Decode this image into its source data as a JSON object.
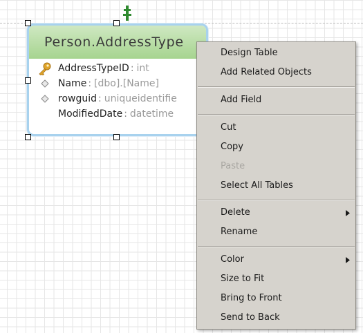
{
  "entity": {
    "title": "Person.AddressType",
    "fields": [
      {
        "name": "AddressTypeID",
        "type": "int",
        "icon": "key-icon"
      },
      {
        "name": "Name",
        "type": "[dbo].[Name]",
        "icon": "diamond-icon"
      },
      {
        "name": "rowguid",
        "type": "uniqueidentifie",
        "icon": "diamond-icon"
      },
      {
        "name": "ModifiedDate",
        "type": "datetime",
        "icon": ""
      }
    ],
    "separator": ":"
  },
  "context_menu": {
    "items": [
      {
        "label": "Design Table"
      },
      {
        "label": "Add Related Objects"
      },
      {
        "label": "Add Field"
      },
      {
        "label": "Cut"
      },
      {
        "label": "Copy"
      },
      {
        "label": "Paste",
        "disabled": true
      },
      {
        "label": "Select All Tables"
      },
      {
        "label": "Delete",
        "submenu": true
      },
      {
        "label": "Rename"
      },
      {
        "label": "Color",
        "submenu": true
      },
      {
        "label": "Size to Fit"
      },
      {
        "label": "Bring to Front"
      },
      {
        "label": "Send to Back"
      }
    ]
  },
  "colors": {
    "header_green": "#a6d48f",
    "table_border": "#a8d2ee",
    "menu_bg": "#d6d3cd",
    "key_gold": "#e0a52a",
    "anchor_green": "#2f8a2f"
  }
}
